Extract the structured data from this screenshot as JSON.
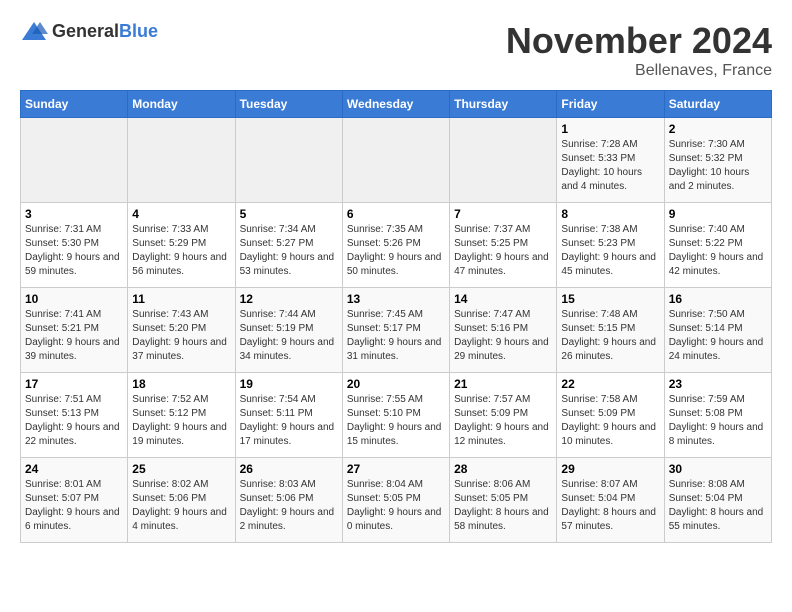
{
  "logo": {
    "general": "General",
    "blue": "Blue"
  },
  "header": {
    "month": "November 2024",
    "location": "Bellenaves, France"
  },
  "weekdays": [
    "Sunday",
    "Monday",
    "Tuesday",
    "Wednesday",
    "Thursday",
    "Friday",
    "Saturday"
  ],
  "weeks": [
    [
      {
        "day": "",
        "sunrise": "",
        "sunset": "",
        "daylight": "",
        "empty": true
      },
      {
        "day": "",
        "sunrise": "",
        "sunset": "",
        "daylight": "",
        "empty": true
      },
      {
        "day": "",
        "sunrise": "",
        "sunset": "",
        "daylight": "",
        "empty": true
      },
      {
        "day": "",
        "sunrise": "",
        "sunset": "",
        "daylight": "",
        "empty": true
      },
      {
        "day": "",
        "sunrise": "",
        "sunset": "",
        "daylight": "",
        "empty": true
      },
      {
        "day": "1",
        "sunrise": "Sunrise: 7:28 AM",
        "sunset": "Sunset: 5:33 PM",
        "daylight": "Daylight: 10 hours and 4 minutes.",
        "empty": false
      },
      {
        "day": "2",
        "sunrise": "Sunrise: 7:30 AM",
        "sunset": "Sunset: 5:32 PM",
        "daylight": "Daylight: 10 hours and 2 minutes.",
        "empty": false
      }
    ],
    [
      {
        "day": "3",
        "sunrise": "Sunrise: 7:31 AM",
        "sunset": "Sunset: 5:30 PM",
        "daylight": "Daylight: 9 hours and 59 minutes.",
        "empty": false
      },
      {
        "day": "4",
        "sunrise": "Sunrise: 7:33 AM",
        "sunset": "Sunset: 5:29 PM",
        "daylight": "Daylight: 9 hours and 56 minutes.",
        "empty": false
      },
      {
        "day": "5",
        "sunrise": "Sunrise: 7:34 AM",
        "sunset": "Sunset: 5:27 PM",
        "daylight": "Daylight: 9 hours and 53 minutes.",
        "empty": false
      },
      {
        "day": "6",
        "sunrise": "Sunrise: 7:35 AM",
        "sunset": "Sunset: 5:26 PM",
        "daylight": "Daylight: 9 hours and 50 minutes.",
        "empty": false
      },
      {
        "day": "7",
        "sunrise": "Sunrise: 7:37 AM",
        "sunset": "Sunset: 5:25 PM",
        "daylight": "Daylight: 9 hours and 47 minutes.",
        "empty": false
      },
      {
        "day": "8",
        "sunrise": "Sunrise: 7:38 AM",
        "sunset": "Sunset: 5:23 PM",
        "daylight": "Daylight: 9 hours and 45 minutes.",
        "empty": false
      },
      {
        "day": "9",
        "sunrise": "Sunrise: 7:40 AM",
        "sunset": "Sunset: 5:22 PM",
        "daylight": "Daylight: 9 hours and 42 minutes.",
        "empty": false
      }
    ],
    [
      {
        "day": "10",
        "sunrise": "Sunrise: 7:41 AM",
        "sunset": "Sunset: 5:21 PM",
        "daylight": "Daylight: 9 hours and 39 minutes.",
        "empty": false
      },
      {
        "day": "11",
        "sunrise": "Sunrise: 7:43 AM",
        "sunset": "Sunset: 5:20 PM",
        "daylight": "Daylight: 9 hours and 37 minutes.",
        "empty": false
      },
      {
        "day": "12",
        "sunrise": "Sunrise: 7:44 AM",
        "sunset": "Sunset: 5:19 PM",
        "daylight": "Daylight: 9 hours and 34 minutes.",
        "empty": false
      },
      {
        "day": "13",
        "sunrise": "Sunrise: 7:45 AM",
        "sunset": "Sunset: 5:17 PM",
        "daylight": "Daylight: 9 hours and 31 minutes.",
        "empty": false
      },
      {
        "day": "14",
        "sunrise": "Sunrise: 7:47 AM",
        "sunset": "Sunset: 5:16 PM",
        "daylight": "Daylight: 9 hours and 29 minutes.",
        "empty": false
      },
      {
        "day": "15",
        "sunrise": "Sunrise: 7:48 AM",
        "sunset": "Sunset: 5:15 PM",
        "daylight": "Daylight: 9 hours and 26 minutes.",
        "empty": false
      },
      {
        "day": "16",
        "sunrise": "Sunrise: 7:50 AM",
        "sunset": "Sunset: 5:14 PM",
        "daylight": "Daylight: 9 hours and 24 minutes.",
        "empty": false
      }
    ],
    [
      {
        "day": "17",
        "sunrise": "Sunrise: 7:51 AM",
        "sunset": "Sunset: 5:13 PM",
        "daylight": "Daylight: 9 hours and 22 minutes.",
        "empty": false
      },
      {
        "day": "18",
        "sunrise": "Sunrise: 7:52 AM",
        "sunset": "Sunset: 5:12 PM",
        "daylight": "Daylight: 9 hours and 19 minutes.",
        "empty": false
      },
      {
        "day": "19",
        "sunrise": "Sunrise: 7:54 AM",
        "sunset": "Sunset: 5:11 PM",
        "daylight": "Daylight: 9 hours and 17 minutes.",
        "empty": false
      },
      {
        "day": "20",
        "sunrise": "Sunrise: 7:55 AM",
        "sunset": "Sunset: 5:10 PM",
        "daylight": "Daylight: 9 hours and 15 minutes.",
        "empty": false
      },
      {
        "day": "21",
        "sunrise": "Sunrise: 7:57 AM",
        "sunset": "Sunset: 5:09 PM",
        "daylight": "Daylight: 9 hours and 12 minutes.",
        "empty": false
      },
      {
        "day": "22",
        "sunrise": "Sunrise: 7:58 AM",
        "sunset": "Sunset: 5:09 PM",
        "daylight": "Daylight: 9 hours and 10 minutes.",
        "empty": false
      },
      {
        "day": "23",
        "sunrise": "Sunrise: 7:59 AM",
        "sunset": "Sunset: 5:08 PM",
        "daylight": "Daylight: 9 hours and 8 minutes.",
        "empty": false
      }
    ],
    [
      {
        "day": "24",
        "sunrise": "Sunrise: 8:01 AM",
        "sunset": "Sunset: 5:07 PM",
        "daylight": "Daylight: 9 hours and 6 minutes.",
        "empty": false
      },
      {
        "day": "25",
        "sunrise": "Sunrise: 8:02 AM",
        "sunset": "Sunset: 5:06 PM",
        "daylight": "Daylight: 9 hours and 4 minutes.",
        "empty": false
      },
      {
        "day": "26",
        "sunrise": "Sunrise: 8:03 AM",
        "sunset": "Sunset: 5:06 PM",
        "daylight": "Daylight: 9 hours and 2 minutes.",
        "empty": false
      },
      {
        "day": "27",
        "sunrise": "Sunrise: 8:04 AM",
        "sunset": "Sunset: 5:05 PM",
        "daylight": "Daylight: 9 hours and 0 minutes.",
        "empty": false
      },
      {
        "day": "28",
        "sunrise": "Sunrise: 8:06 AM",
        "sunset": "Sunset: 5:05 PM",
        "daylight": "Daylight: 8 hours and 58 minutes.",
        "empty": false
      },
      {
        "day": "29",
        "sunrise": "Sunrise: 8:07 AM",
        "sunset": "Sunset: 5:04 PM",
        "daylight": "Daylight: 8 hours and 57 minutes.",
        "empty": false
      },
      {
        "day": "30",
        "sunrise": "Sunrise: 8:08 AM",
        "sunset": "Sunset: 5:04 PM",
        "daylight": "Daylight: 8 hours and 55 minutes.",
        "empty": false
      }
    ]
  ]
}
